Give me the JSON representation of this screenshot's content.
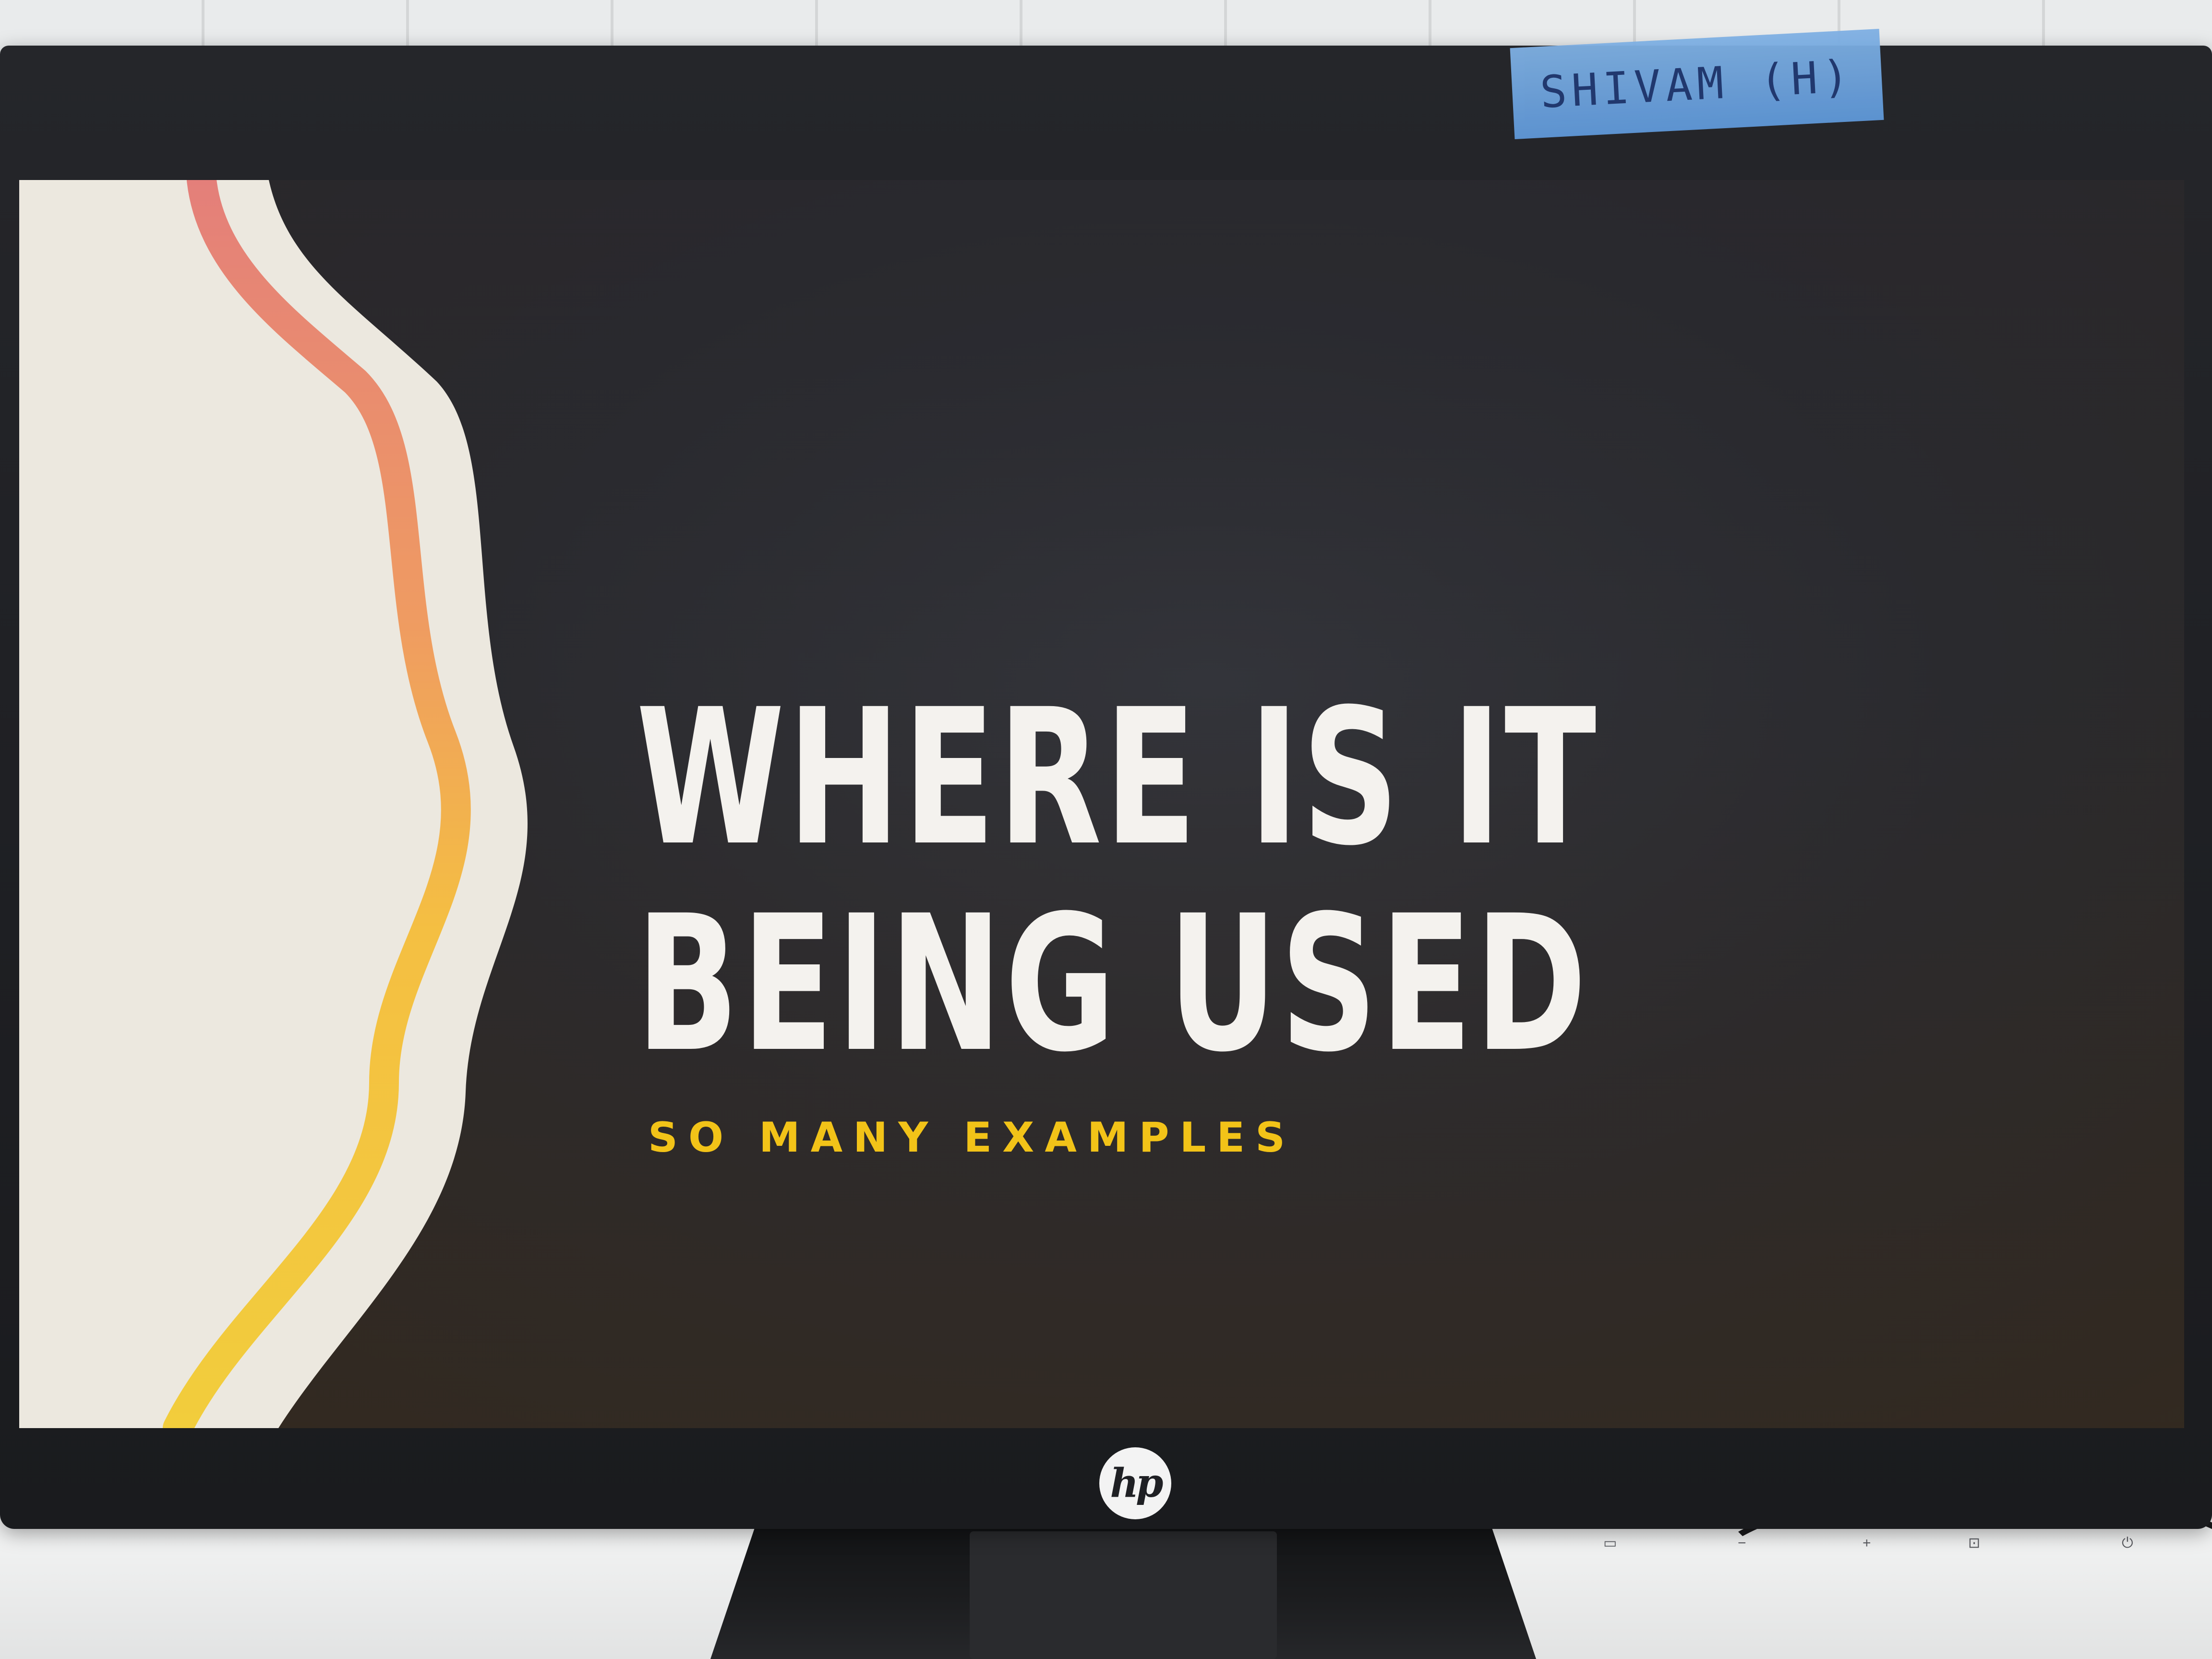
{
  "slide": {
    "title_line1": "WHERE IS IT",
    "title_line2": "BEING USED",
    "subtitle": "SO MANY EXAMPLES"
  },
  "monitor": {
    "brand_logo": "hp",
    "tape_label": "SHIVAM (H)"
  },
  "colors": {
    "screen_background": "#2a2a2e",
    "title_text": "#f4f2ee",
    "subtitle_text": "#f2c318",
    "deco_panel": "#ece8df",
    "deco_stripe_top": "#e47f7a",
    "deco_stripe_bottom": "#f4c93a",
    "tape": "#6fa3dd"
  },
  "icons": {
    "brand": "hp-logo-icon",
    "monitor_buttons": [
      "menu-icon",
      "minus-icon",
      "plus-icon",
      "input-icon",
      "power-icon"
    ]
  }
}
